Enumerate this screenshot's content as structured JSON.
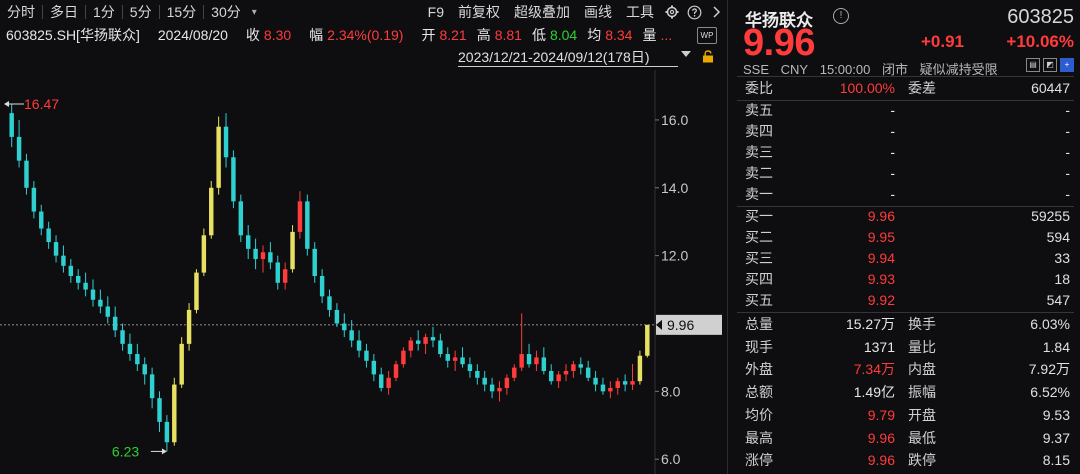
{
  "toolbar": {
    "items": [
      "分时",
      "多日",
      "1分",
      "5分",
      "15分",
      "30分"
    ],
    "dropdown": "▾",
    "right_items": [
      "F9",
      "前复权",
      "超级叠加",
      "画线",
      "工具"
    ]
  },
  "info": {
    "code": "603825.SH[华扬联众]",
    "date": "2024/08/20",
    "close_label": "收",
    "close": "8.30",
    "range_label": "幅",
    "range": "2.34%(0.19)",
    "open_label": "开",
    "open": "8.21",
    "high_label": "高",
    "high": "8.81",
    "low_label": "低",
    "low": "8.04",
    "avg_label": "均",
    "avg": "8.34",
    "vol_label": "量",
    "vol": "...",
    "wp": "WP"
  },
  "date_range": "2023/12/21-2024/09/12(178日)",
  "chart_data": {
    "type": "candlestick",
    "ylim": [
      5.8,
      17.0
    ],
    "yticks": [
      "16.0",
      "14.0",
      "12.0",
      "8.0",
      "6.0"
    ],
    "ytick_values": [
      16.0,
      14.0,
      12.0,
      8.0,
      6.0
    ],
    "max_label": "16.47",
    "min_label": "6.23",
    "current_price": "9.96",
    "current_value": 9.96,
    "candles": [
      [
        16.2,
        16.47,
        15.2,
        15.5
      ],
      [
        15.5,
        16.0,
        14.6,
        14.8
      ],
      [
        14.8,
        15.0,
        13.8,
        14.0
      ],
      [
        14.0,
        14.2,
        13.1,
        13.3
      ],
      [
        13.3,
        13.5,
        12.6,
        12.8
      ],
      [
        12.8,
        13.0,
        12.2,
        12.4
      ],
      [
        12.4,
        12.6,
        11.8,
        12.0
      ],
      [
        12.0,
        12.3,
        11.5,
        11.7
      ],
      [
        11.7,
        11.9,
        11.2,
        11.4
      ],
      [
        11.4,
        11.6,
        11.0,
        11.2
      ],
      [
        11.2,
        11.5,
        10.8,
        11.0
      ],
      [
        11.0,
        11.3,
        10.5,
        10.7
      ],
      [
        10.7,
        11.0,
        10.3,
        10.5
      ],
      [
        10.5,
        10.8,
        10.0,
        10.2
      ],
      [
        10.2,
        10.5,
        9.6,
        9.8
      ],
      [
        9.8,
        10.0,
        9.2,
        9.4
      ],
      [
        9.4,
        9.7,
        8.9,
        9.1
      ],
      [
        9.1,
        9.4,
        8.6,
        8.8
      ],
      [
        8.8,
        9.0,
        8.2,
        8.5
      ],
      [
        8.5,
        8.7,
        7.5,
        7.8
      ],
      [
        7.8,
        8.0,
        6.8,
        7.1
      ],
      [
        7.1,
        7.3,
        6.23,
        6.5
      ],
      [
        6.5,
        8.4,
        6.4,
        8.2
      ],
      [
        8.2,
        9.6,
        8.1,
        9.4
      ],
      [
        9.4,
        10.6,
        9.2,
        10.4
      ],
      [
        10.4,
        11.6,
        10.3,
        11.5
      ],
      [
        11.5,
        12.8,
        11.4,
        12.6
      ],
      [
        12.6,
        14.2,
        12.5,
        14.0
      ],
      [
        14.0,
        16.1,
        13.8,
        15.8
      ],
      [
        15.8,
        16.2,
        14.6,
        14.9
      ],
      [
        14.9,
        15.1,
        13.4,
        13.6
      ],
      [
        13.6,
        13.8,
        12.4,
        12.6
      ],
      [
        12.6,
        12.9,
        11.9,
        12.2
      ],
      [
        12.2,
        12.5,
        11.6,
        11.9
      ],
      [
        11.9,
        12.3,
        11.5,
        12.1
      ],
      [
        12.1,
        12.4,
        11.6,
        11.8
      ],
      [
        11.8,
        12.0,
        11.0,
        11.2
      ],
      [
        11.2,
        11.8,
        11.0,
        11.6
      ],
      [
        11.6,
        12.9,
        11.5,
        12.7
      ],
      [
        12.7,
        13.9,
        12.5,
        13.6
      ],
      [
        13.6,
        13.8,
        12.0,
        12.2
      ],
      [
        12.2,
        12.4,
        11.2,
        11.4
      ],
      [
        11.4,
        11.6,
        10.6,
        10.8
      ],
      [
        10.8,
        11.0,
        10.2,
        10.4
      ],
      [
        10.4,
        10.6,
        9.9,
        10.0
      ],
      [
        10.0,
        10.3,
        9.6,
        9.8
      ],
      [
        9.8,
        10.1,
        9.3,
        9.5
      ],
      [
        9.5,
        9.8,
        9.0,
        9.2
      ],
      [
        9.2,
        9.4,
        8.7,
        8.9
      ],
      [
        8.9,
        9.1,
        8.3,
        8.5
      ],
      [
        8.5,
        8.7,
        8.0,
        8.1
      ],
      [
        8.1,
        8.6,
        7.9,
        8.4
      ],
      [
        8.4,
        8.9,
        8.3,
        8.8
      ],
      [
        8.8,
        9.3,
        8.7,
        9.2
      ],
      [
        9.2,
        9.6,
        9.0,
        9.5
      ],
      [
        9.5,
        9.8,
        9.2,
        9.4
      ],
      [
        9.4,
        9.7,
        9.1,
        9.6
      ],
      [
        9.6,
        9.9,
        9.3,
        9.5
      ],
      [
        9.5,
        9.7,
        9.0,
        9.1
      ],
      [
        9.1,
        9.3,
        8.7,
        8.9
      ],
      [
        8.9,
        9.2,
        8.6,
        9.0
      ],
      [
        9.0,
        9.3,
        8.7,
        8.8
      ],
      [
        8.8,
        9.0,
        8.4,
        8.6
      ],
      [
        8.6,
        8.8,
        8.2,
        8.4
      ],
      [
        8.4,
        8.6,
        8.0,
        8.2
      ],
      [
        8.2,
        8.4,
        7.8,
        8.0
      ],
      [
        8.0,
        8.3,
        7.7,
        8.1
      ],
      [
        8.1,
        8.5,
        7.9,
        8.4
      ],
      [
        8.4,
        8.8,
        8.3,
        8.7
      ],
      [
        8.7,
        10.3,
        8.6,
        9.1
      ],
      [
        9.1,
        9.4,
        8.7,
        8.8
      ],
      [
        8.8,
        9.2,
        8.6,
        9.0
      ],
      [
        9.0,
        9.3,
        8.5,
        8.6
      ],
      [
        8.6,
        8.8,
        8.2,
        8.3
      ],
      [
        8.3,
        8.6,
        8.1,
        8.5
      ],
      [
        8.5,
        8.8,
        8.3,
        8.6
      ],
      [
        8.6,
        8.9,
        8.4,
        8.8
      ],
      [
        8.8,
        9.0,
        8.5,
        8.7
      ],
      [
        8.7,
        8.9,
        8.3,
        8.4
      ],
      [
        8.4,
        8.6,
        8.0,
        8.2
      ],
      [
        8.2,
        8.4,
        7.9,
        8.0
      ],
      [
        8.0,
        8.3,
        7.8,
        8.1
      ],
      [
        8.1,
        8.4,
        7.9,
        8.3
      ],
      [
        8.3,
        8.5,
        8.0,
        8.2
      ],
      [
        8.2,
        8.81,
        8.04,
        8.3
      ],
      [
        8.3,
        9.2,
        8.2,
        9.05
      ],
      [
        9.05,
        9.96,
        9.0,
        9.96
      ]
    ]
  },
  "panel": {
    "name": "华扬联众",
    "code": "603825",
    "price": "9.96",
    "change": "+0.91",
    "change_pct": "+10.06%",
    "sub": [
      "SSE",
      "CNY",
      "15:00:00",
      "闭市",
      "疑似减持受限"
    ],
    "ratio_label": "委比",
    "ratio_value": "100.00%",
    "diff_label": "委差",
    "diff_value": "60447",
    "asks": [
      {
        "label": "卖五",
        "price": "-",
        "vol": "-"
      },
      {
        "label": "卖四",
        "price": "-",
        "vol": "-"
      },
      {
        "label": "卖三",
        "price": "-",
        "vol": "-"
      },
      {
        "label": "卖二",
        "price": "-",
        "vol": "-"
      },
      {
        "label": "卖一",
        "price": "-",
        "vol": "-"
      }
    ],
    "bids": [
      {
        "label": "买一",
        "price": "9.96",
        "vol": "59255"
      },
      {
        "label": "买二",
        "price": "9.95",
        "vol": "594"
      },
      {
        "label": "买三",
        "price": "9.94",
        "vol": "33"
      },
      {
        "label": "买四",
        "price": "9.93",
        "vol": "18"
      },
      {
        "label": "买五",
        "price": "9.92",
        "vol": "547"
      }
    ],
    "stats": [
      {
        "l1": "总量",
        "v1": "15.27万",
        "c1": "white",
        "l2": "换手",
        "v2": "6.03%",
        "c2": "white"
      },
      {
        "l1": "现手",
        "v1": "1371",
        "c1": "white",
        "l2": "量比",
        "v2": "1.84",
        "c2": "white"
      },
      {
        "l1": "外盘",
        "v1": "7.34万",
        "c1": "red",
        "l2": "内盘",
        "v2": "7.92万",
        "c2": "green"
      },
      {
        "l1": "总额",
        "v1": "1.49亿",
        "c1": "white",
        "l2": "振幅",
        "v2": "6.52%",
        "c2": "white"
      },
      {
        "l1": "均价",
        "v1": "9.79",
        "c1": "red",
        "l2": "开盘",
        "v2": "9.53",
        "c2": "red"
      },
      {
        "l1": "最高",
        "v1": "9.96",
        "c1": "red",
        "l2": "最低",
        "v2": "9.37",
        "c2": "red"
      },
      {
        "l1": "涨停",
        "v1": "9.96",
        "c1": "red",
        "l2": "跌停",
        "v2": "8.15",
        "c2": "green"
      }
    ]
  },
  "colors": {
    "up": "#ff3b3b",
    "down": "#2ed0d0",
    "flat": "#e8e060",
    "green": "#2ed12e"
  }
}
